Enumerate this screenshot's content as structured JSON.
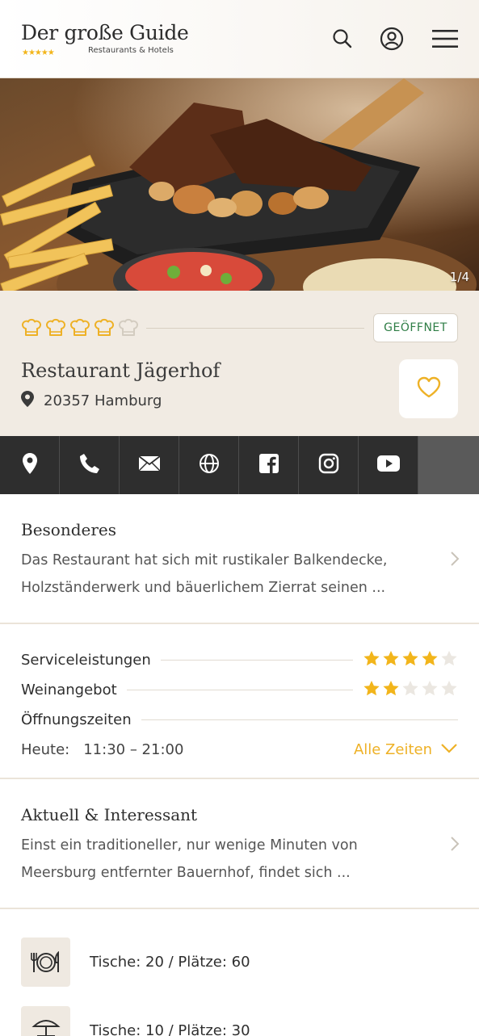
{
  "brand": {
    "title": "Der große Guide",
    "stars": "★★★★★",
    "subtitle": "Restaurants & Hotels"
  },
  "header_icons": [
    "search-icon",
    "account-icon",
    "menu-icon"
  ],
  "hero": {
    "image_counter": "1/4"
  },
  "restaurant": {
    "hat_rating": 4,
    "hat_max": 5,
    "status": "GEÖFFNET",
    "name": "Restaurant Jägerhof",
    "location": "20357 Hamburg"
  },
  "action_icons": [
    "location-icon",
    "phone-icon",
    "email-icon",
    "website-icon",
    "facebook-icon",
    "instagram-icon",
    "youtube-icon"
  ],
  "besonderes": {
    "title": "Besonderes",
    "text": "Das Restaurant hat sich mit rustikaler Balkendecke, Holzständerwerk und bäuerlichem Zierrat seinen ..."
  },
  "ratings": [
    {
      "label": "Serviceleistungen",
      "value": 4,
      "max": 5
    },
    {
      "label": "Weinangebot",
      "value": 2,
      "max": 5
    }
  ],
  "hours": {
    "label": "Öffnungszeiten",
    "today_label": "Heute:",
    "today_value": "11:30 – 21:00",
    "all_link": "Alle Zeiten"
  },
  "aktuell": {
    "title": "Aktuell & Interessant",
    "text": "Einst ein traditioneller, nur wenige Minuten von Meersburg entfernter Bauernhof, findet sich ..."
  },
  "facilities": [
    {
      "icon": "plate-cutlery-icon",
      "text": "Tische: 20 / Plätze: 60"
    },
    {
      "icon": "terrace-umbrella-icon",
      "text": "Tische: 10 / Plätze: 30"
    }
  ],
  "colors": {
    "accent": "#eeb126",
    "status_green": "#2e7d45",
    "info_bg": "#f1ebe3",
    "action_bar": "#2e2e2e"
  }
}
